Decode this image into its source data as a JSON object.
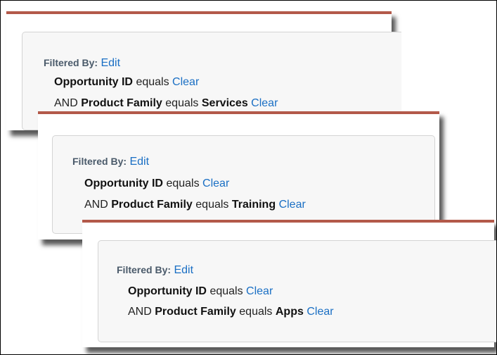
{
  "panels": [
    {
      "filtered_label": "Filtered By:",
      "edit_label": "Edit",
      "line1": {
        "field": "Opportunity ID",
        "op": "equals",
        "clear": "Clear"
      },
      "line2": {
        "prefix": "AND",
        "field": "Product Family",
        "op": "equals",
        "value": "Services",
        "clear": "Clear"
      }
    },
    {
      "filtered_label": "Filtered By:",
      "edit_label": "Edit",
      "line1": {
        "field": "Opportunity ID",
        "op": "equals",
        "clear": "Clear"
      },
      "line2": {
        "prefix": "AND",
        "field": "Product Family",
        "op": "equals",
        "value": "Training",
        "clear": "Clear"
      }
    },
    {
      "filtered_label": "Filtered By:",
      "edit_label": "Edit",
      "line1": {
        "field": "Opportunity ID",
        "op": "equals",
        "clear": "Clear"
      },
      "line2": {
        "prefix": "AND",
        "field": "Product Family",
        "op": "equals",
        "value": "Apps",
        "clear": "Clear"
      }
    }
  ],
  "colors": {
    "accent_border": "#b3594a",
    "link": "#1a6fc4",
    "label": "#4a5a6a"
  }
}
